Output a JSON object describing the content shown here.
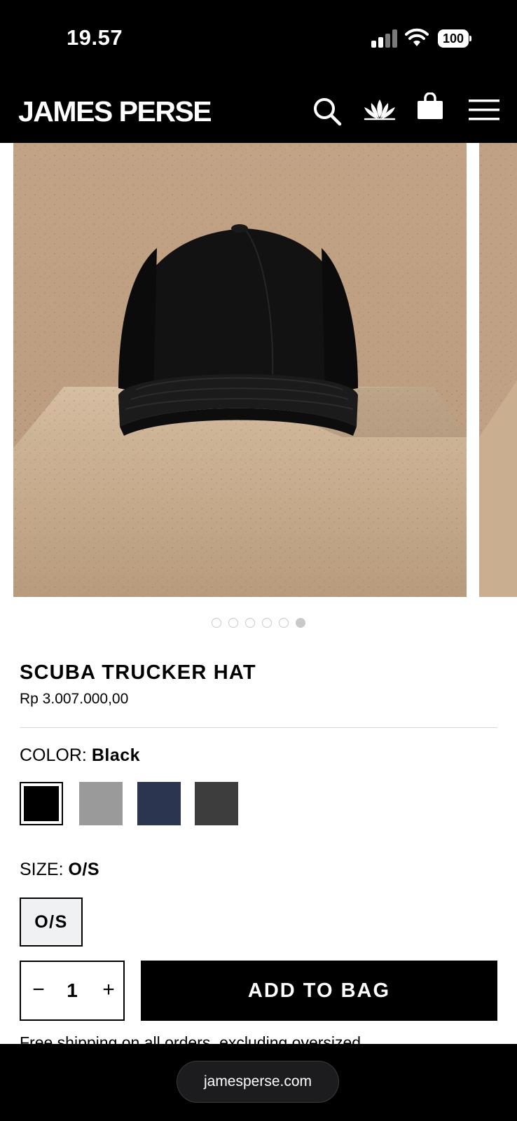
{
  "status_bar": {
    "time": "19.57",
    "battery": "100"
  },
  "header": {
    "logo": "JAMES PERSE",
    "icons": [
      "search-icon",
      "lotus-icon",
      "shopping-bag-icon",
      "menu-icon"
    ]
  },
  "gallery": {
    "slide_count": 6,
    "active_index": 5
  },
  "product": {
    "title": "SCUBA TRUCKER HAT",
    "price": "Rp 3.007.000,00"
  },
  "color": {
    "label": "COLOR:",
    "selected": "Black",
    "swatches": [
      {
        "name": "Black",
        "hex": "#000000"
      },
      {
        "name": "Grey",
        "hex": "#9a9a9a"
      },
      {
        "name": "Navy",
        "hex": "#2b3550"
      },
      {
        "name": "Charcoal",
        "hex": "#3d3d3d"
      }
    ]
  },
  "size": {
    "label": "SIZE:",
    "selected": "O/S",
    "options": [
      "O/S"
    ]
  },
  "quantity": {
    "minus": "−",
    "value": "1",
    "plus": "+"
  },
  "cta": {
    "add_to_bag": "ADD TO BAG"
  },
  "shipping_note": "Free shipping on all orders, excluding oversized",
  "browser": {
    "url": "jamesperse.com"
  }
}
